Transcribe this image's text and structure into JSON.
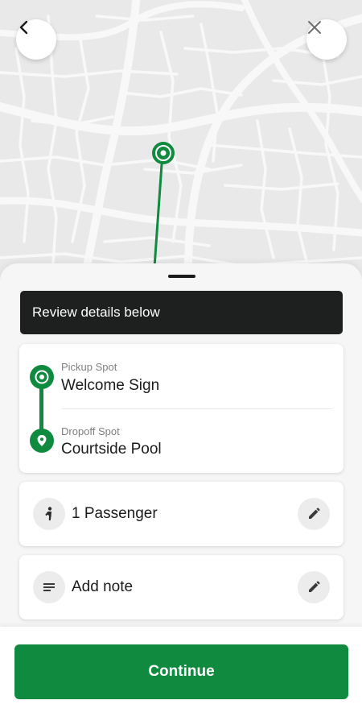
{
  "map": {
    "route_color": "#0f8a3e",
    "back_icon": "chevron-left-icon",
    "close_icon": "close-icon"
  },
  "sheet": {
    "banner": "Review details below",
    "pickup": {
      "label": "Pickup Spot",
      "name": "Welcome Sign"
    },
    "dropoff": {
      "label": "Dropoff Spot",
      "name": "Courtside Pool"
    },
    "passengers": {
      "text": "1 Passenger",
      "icon": "person-icon",
      "edit_icon": "pencil-icon"
    },
    "note": {
      "text": "Add note",
      "icon": "notes-icon",
      "edit_icon": "pencil-icon"
    }
  },
  "footer": {
    "continue_label": "Continue"
  },
  "colors": {
    "accent": "#0f8a3e",
    "banner_bg": "#1e1f1f"
  }
}
